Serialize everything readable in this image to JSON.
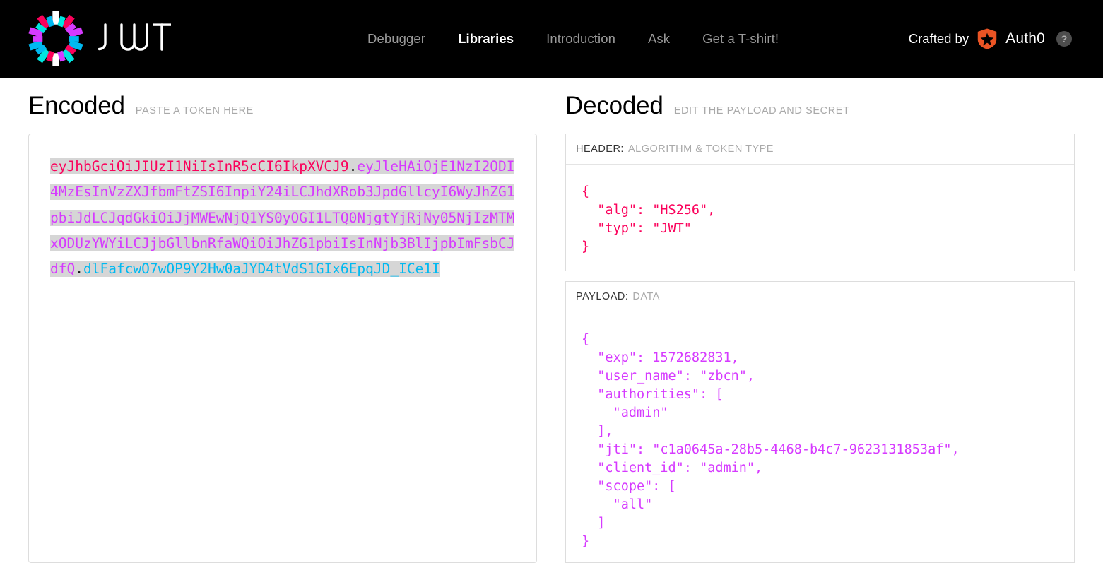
{
  "brand": {
    "wordmark": "JWT",
    "logo_icon": "jwt-starburst-icon",
    "colors": {
      "cyan": "#00e5e0",
      "magenta": "#fb015b",
      "purple": "#d63aff",
      "blue": "#00b9f1",
      "white": "#ffffff"
    }
  },
  "nav": {
    "items": [
      {
        "label": "Debugger",
        "active": false
      },
      {
        "label": "Libraries",
        "active": true
      },
      {
        "label": "Introduction",
        "active": false
      },
      {
        "label": "Ask",
        "active": false
      },
      {
        "label": "Get a T-shirt!",
        "active": false
      }
    ]
  },
  "crafted": {
    "label": "Crafted by",
    "company": "Auth0",
    "logo_icon": "auth0-shield-icon",
    "logo_color": "#eb5424",
    "help_icon": "question-mark-icon",
    "help_label": "?"
  },
  "encoded": {
    "title": "Encoded",
    "subtitle": "PASTE A TOKEN HERE",
    "token": {
      "header": "eyJhbGciOiJIUzI1NiIsInR5cCI6IkpXVCJ9",
      "payload": "eyJleHAiOjE1NzI2ODI4MzEsInVzZXJfbmFtZSI6InpiY24iLCJhdXRob3JpdGllcyI6WyJhZG1pbiJdLCJqdGkiOiJjMWEwNjQ1YS0yOGI1LTQ0NjgtYjRjNy05NjIzMTMxODUzYWYiLCJjbGllbnRfaWQiOiJhZG1pbiIsInNjb3BlIjpbImFsbCJdfQ",
      "signature": "dlFafcwO7wOP9Y2Hw0aJYD4tVdS1GIx6EpqJD_ICe1I",
      "separator": "."
    }
  },
  "decoded": {
    "title": "Decoded",
    "subtitle": "EDIT THE PAYLOAD AND SECRET",
    "header_section": {
      "key": "HEADER:",
      "desc": "ALGORITHM & TOKEN TYPE",
      "json": "{\n  \"alg\": \"HS256\",\n  \"typ\": \"JWT\"\n}"
    },
    "payload_section": {
      "key": "PAYLOAD:",
      "desc": "DATA",
      "json": "{\n  \"exp\": 1572682831,\n  \"user_name\": \"zbcn\",\n  \"authorities\": [\n    \"admin\"\n  ],\n  \"jti\": \"c1a0645a-28b5-4468-b4c7-9623131853af\",\n  \"client_id\": \"admin\",\n  \"scope\": [\n    \"all\"\n  ]\n}"
    }
  }
}
